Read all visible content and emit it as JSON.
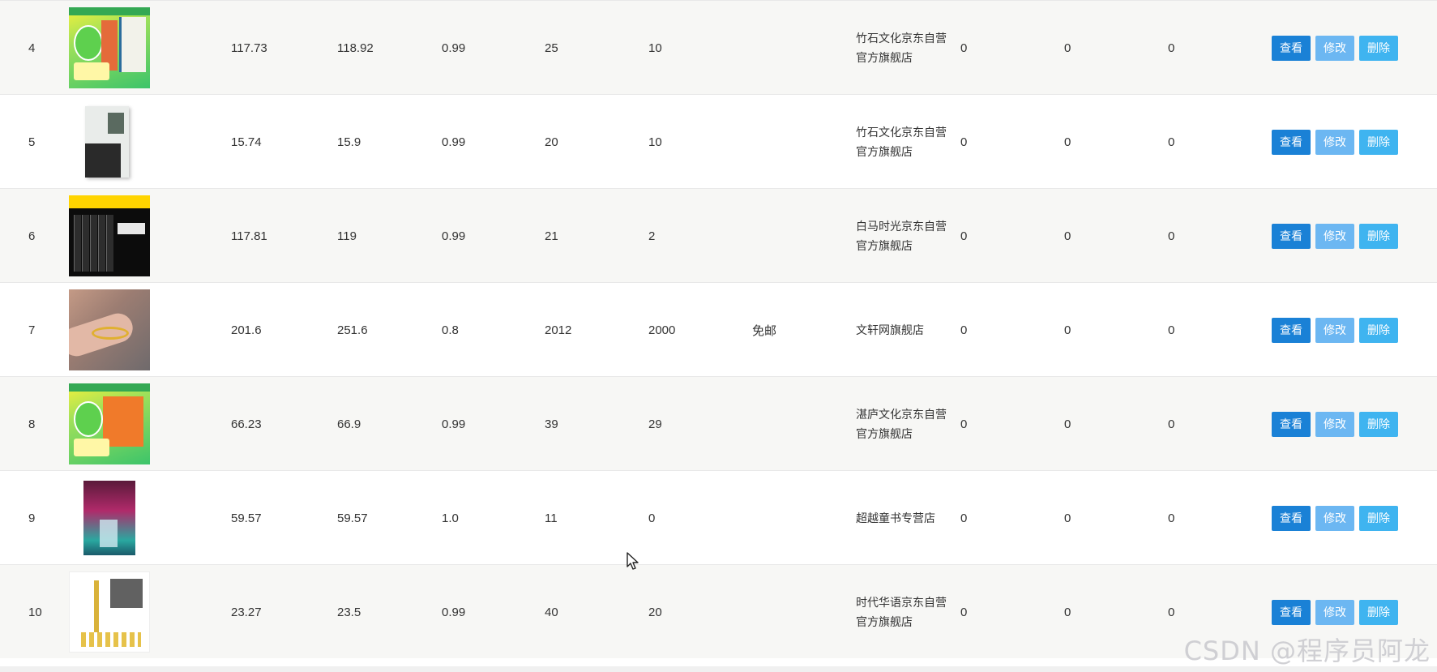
{
  "rows": [
    {
      "index": "4",
      "price": "117.73",
      "original_price": "118.92",
      "discount": "0.99",
      "n1": "25",
      "n2": "10",
      "shipping": "",
      "shop_line1": "竹石文化京东自营",
      "shop_line2": "官方旗舰店",
      "z1": "0",
      "z2": "0",
      "z3": "0",
      "thumb": "green-promo-books"
    },
    {
      "index": "5",
      "price": "15.74",
      "original_price": "15.9",
      "discount": "0.99",
      "n1": "20",
      "n2": "10",
      "shipping": "",
      "shop_line1": "竹石文化京东自营",
      "shop_line2": "官方旗舰店",
      "z1": "0",
      "z2": "0",
      "z3": "0",
      "thumb": "grey-book-cover"
    },
    {
      "index": "6",
      "price": "117.81",
      "original_price": "119",
      "discount": "0.99",
      "n1": "21",
      "n2": "2",
      "shipping": "",
      "shop_line1": "白马时光京东自营",
      "shop_line2": "官方旗舰店",
      "z1": "0",
      "z2": "0",
      "z3": "0",
      "thumb": "black-book-set"
    },
    {
      "index": "7",
      "price": "201.6",
      "original_price": "251.6",
      "discount": "0.8",
      "n1": "2012",
      "n2": "2000",
      "shipping": "免邮",
      "shop_line1": "文轩网旗舰店",
      "shop_line2": "",
      "z1": "0",
      "z2": "0",
      "z3": "0",
      "thumb": "bracelet-photo"
    },
    {
      "index": "8",
      "price": "66.23",
      "original_price": "66.9",
      "discount": "0.99",
      "n1": "39",
      "n2": "29",
      "shipping": "",
      "shop_line1": "湛庐文化京东自营",
      "shop_line2": "官方旗舰店",
      "z1": "0",
      "z2": "0",
      "z3": "0",
      "thumb": "green-promo-orange-book"
    },
    {
      "index": "9",
      "price": "59.57",
      "original_price": "59.57",
      "discount": "1.0",
      "n1": "11",
      "n2": "0",
      "shipping": "",
      "shop_line1": "超越童书专营店",
      "shop_line2": "",
      "z1": "0",
      "z2": "0",
      "z3": "0",
      "thumb": "neon-book-cover"
    },
    {
      "index": "10",
      "price": "23.27",
      "original_price": "23.5",
      "discount": "0.99",
      "n1": "40",
      "n2": "20",
      "shipping": "",
      "shop_line1": "时代华语京东自营",
      "shop_line2": "官方旗舰店",
      "z1": "0",
      "z2": "0",
      "z3": "0",
      "thumb": "white-book-cover"
    }
  ],
  "actions": {
    "view_label": "查看",
    "edit_label": "修改",
    "delete_label": "删除"
  },
  "watermark": "CSDN @程序员阿龙",
  "colors": {
    "view_button": "#1a81d6",
    "edit_button": "#6cb7f2",
    "delete_button": "#3fb4f0",
    "row_alt": "#f7f7f5"
  }
}
